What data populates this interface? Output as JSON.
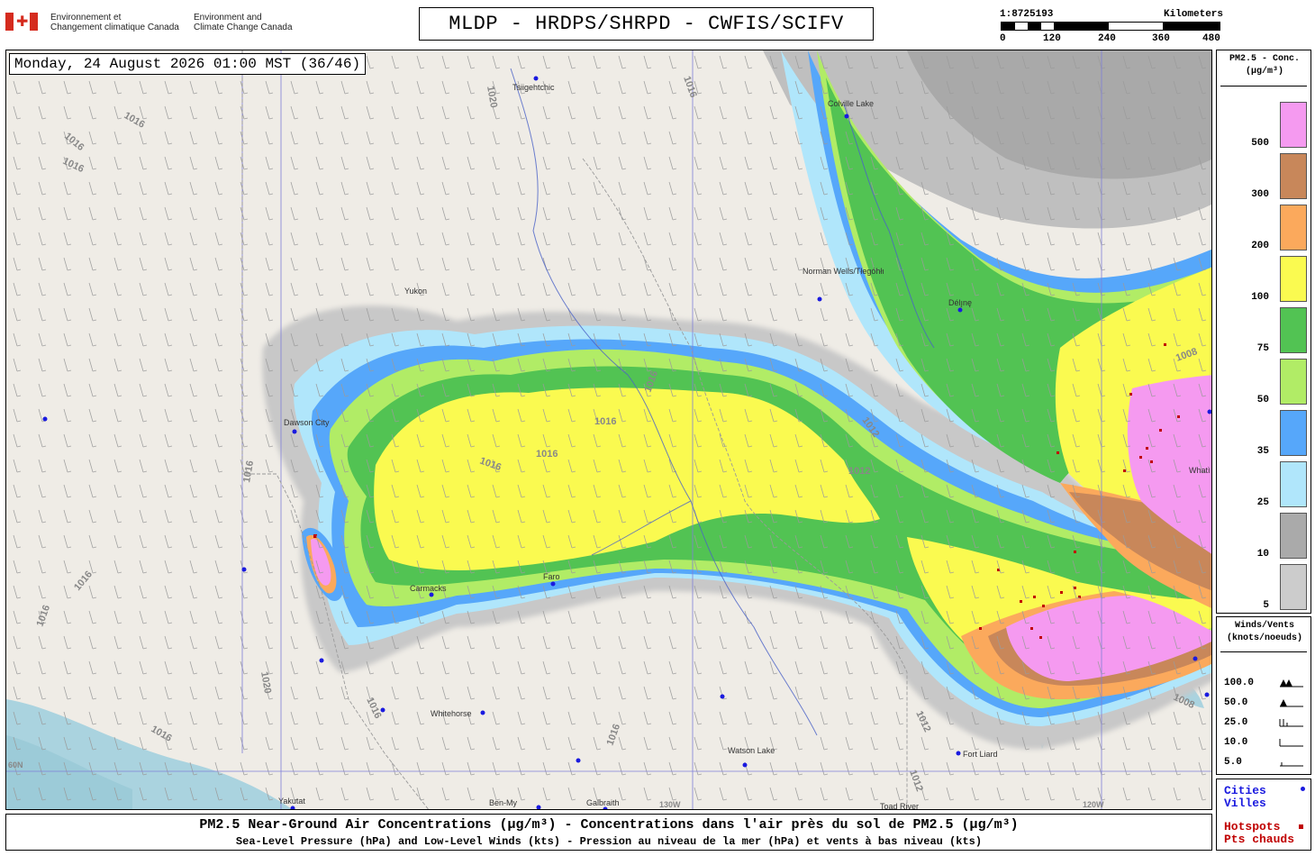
{
  "header": {
    "gov_fr": "Environnement et",
    "gov_fr2": "Changement climatique Canada",
    "gov_en": "Environment and",
    "gov_en2": "Climate Change Canada",
    "title": "MLDP - HRDPS/SHRPD - CWFIS/SCIFV"
  },
  "scale": {
    "ratio": "1:8725193",
    "units": "Kilometers",
    "ticks": [
      "0",
      "120",
      "240",
      "360",
      "480"
    ]
  },
  "map": {
    "timestamp": "Monday, 24 August 2026 01:00 MST (36/46)",
    "cities": [
      {
        "name": "Tsiigehtchic"
      },
      {
        "name": "Colville Lake"
      },
      {
        "name": "Norman Wells/Tłegóhłı"
      },
      {
        "name": "Délı̨nę"
      },
      {
        "name": "Dawson City"
      },
      {
        "name": "Carmacks"
      },
      {
        "name": "Faro"
      },
      {
        "name": "Whitehorse"
      },
      {
        "name": "Watson Lake"
      },
      {
        "name": "Fort Liard"
      },
      {
        "name": "Whatì"
      },
      {
        "name": "Yakutat"
      },
      {
        "name": "Ben-My"
      },
      {
        "name": "Galbraith"
      },
      {
        "name": "Toad River"
      },
      {
        "name": "Yukon"
      }
    ],
    "isobars": [
      "1016",
      "1016",
      "1020",
      "1016",
      "1016",
      "1016",
      "1016",
      "1012",
      "1012",
      "1008",
      "1012",
      "1012",
      "1016",
      "1016",
      "1016",
      "1020",
      "1016",
      "1016",
      "1016",
      "1016",
      "1016",
      "1008"
    ],
    "grid_labels": [
      "60N",
      "130W",
      "120W"
    ]
  },
  "legend_pm": {
    "title1": "PM2.5 - Conc.",
    "title2": "(µg/m³)",
    "levels": [
      {
        "label": "500",
        "color": "#f59af0"
      },
      {
        "label": "300",
        "color": "#c8875a"
      },
      {
        "label": "200",
        "color": "#fba95c"
      },
      {
        "label": "100",
        "color": "#fafa50"
      },
      {
        "label": "75",
        "color": "#52c353"
      },
      {
        "label": "50",
        "color": "#b1ec66"
      },
      {
        "label": "35",
        "color": "#56a7fa"
      },
      {
        "label": "25",
        "color": "#b0e6fb"
      },
      {
        "label": "10",
        "color": "#aaaaaa"
      },
      {
        "label": "5",
        "color": "#cccccc"
      }
    ]
  },
  "legend_wind": {
    "title1": "Winds/Vents",
    "title2": "(knots/noeuds)",
    "rows": [
      "100.0",
      "50.0",
      "25.0",
      "10.0",
      "5.0"
    ]
  },
  "legend_key": {
    "cities_en": "Cities",
    "cities_fr": "Villes",
    "hot_en": "Hotspots",
    "hot_fr": "Pts chauds"
  },
  "footer": {
    "line1": "PM2.5 Near-Ground Air Concentrations (µg/m³) - Concentrations dans l'air près du sol de PM2.5 (µg/m³)",
    "line2": "Sea-Level Pressure (hPa) and Low-Level Winds (kts) - Pression au niveau de la mer (hPa) et vents à bas niveau (kts)"
  }
}
